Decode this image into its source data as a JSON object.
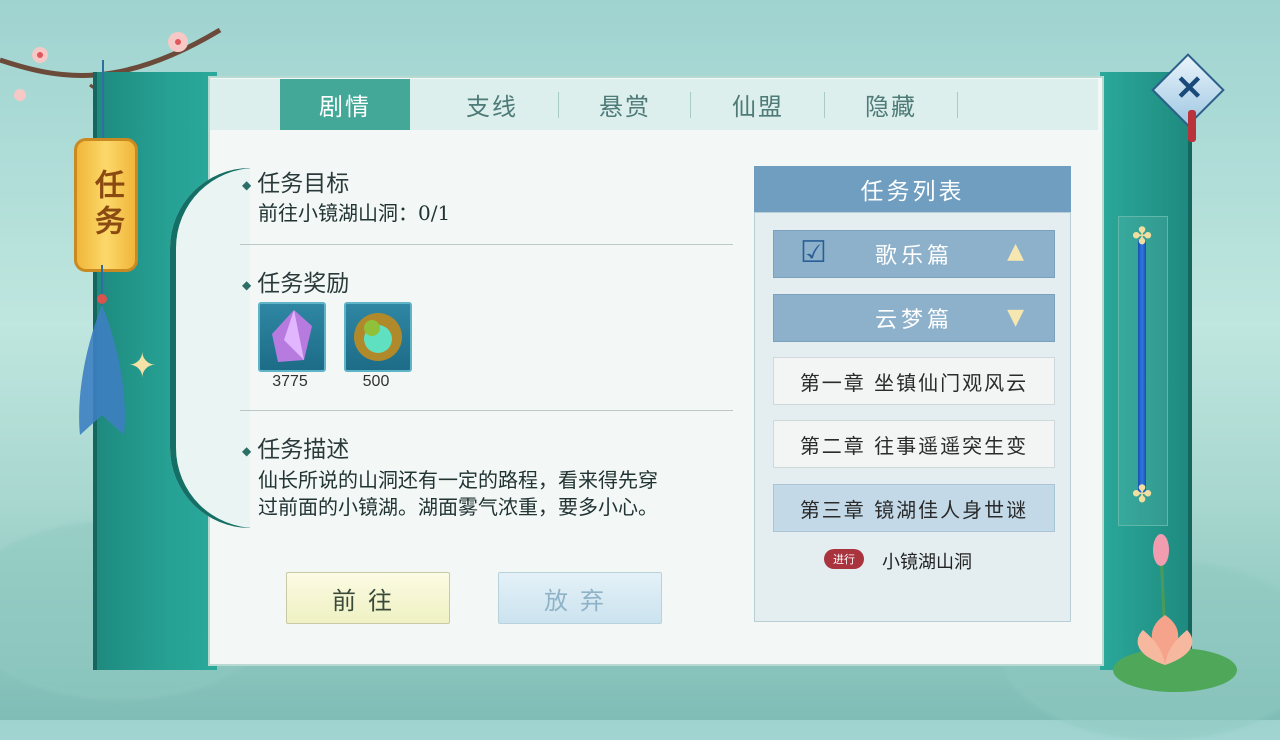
{
  "window": {
    "title": "任务"
  },
  "tabs": [
    {
      "label": "剧情",
      "active": true
    },
    {
      "label": "支线",
      "active": false
    },
    {
      "label": "悬赏",
      "active": false
    },
    {
      "label": "仙盟",
      "active": false
    },
    {
      "label": "隐藏",
      "active": false
    }
  ],
  "objective": {
    "title": "任务目标",
    "text": "前往小镜湖山洞：0/1"
  },
  "rewards": {
    "title": "任务奖励",
    "items": [
      {
        "icon": "purple-crystal-icon",
        "count": "3775"
      },
      {
        "icon": "jade-orb-icon",
        "count": "500"
      }
    ]
  },
  "description": {
    "title": "任务描述",
    "line1": "仙长所说的山洞还有一定的路程，看来得先穿",
    "line2": "过前面的小镜湖。湖面雾气浓重，要多小心。"
  },
  "buttons": {
    "go": "前往",
    "abandon": "放弃"
  },
  "quest_list": {
    "title": "任务列表",
    "groups": [
      {
        "label": "歌乐篇",
        "expanded": false,
        "checked": true
      },
      {
        "label": "云梦篇",
        "expanded": true,
        "checked": false
      }
    ],
    "chapters": [
      {
        "label": "第一章 坐镇仙门观风云",
        "selected": false
      },
      {
        "label": "第二章 往事遥遥突生变",
        "selected": false
      },
      {
        "label": "第三章 镜湖佳人身世谜",
        "selected": true
      }
    ],
    "sub_quest": {
      "status": "进行",
      "label": "小镜湖山洞"
    }
  },
  "colors": {
    "accent": "#43a897",
    "frame": "#1f8a7f",
    "list_header": "#6f9ec0",
    "status_badge": "#a9343e"
  }
}
